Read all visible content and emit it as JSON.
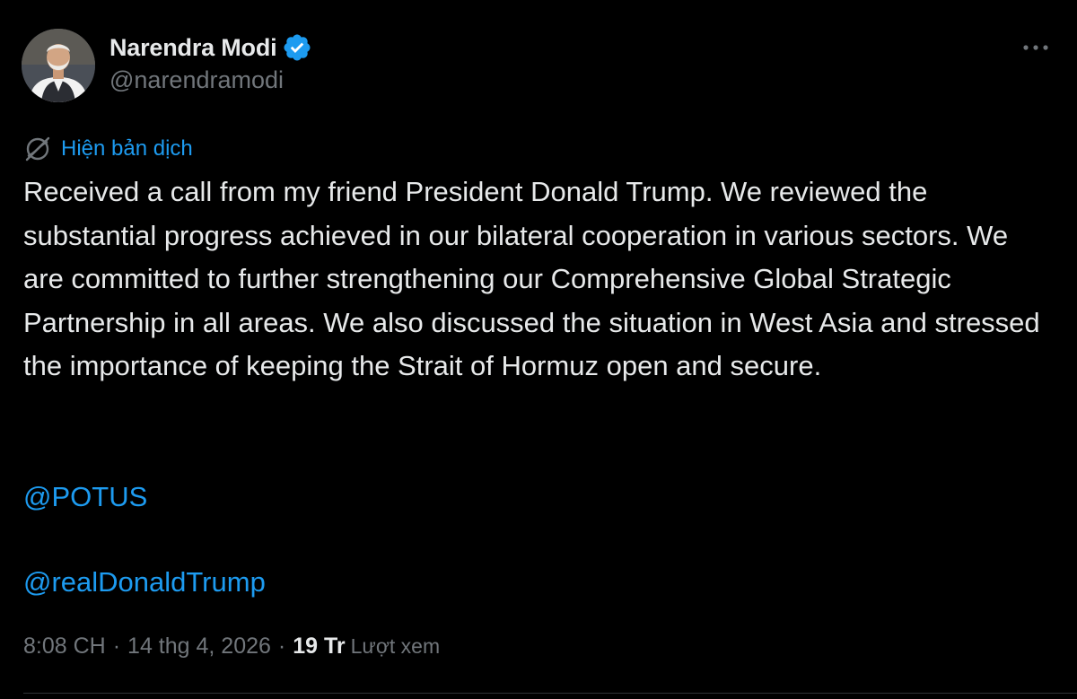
{
  "author": {
    "display_name": "Narendra Modi",
    "handle": "@narendramodi",
    "verified": true
  },
  "translate": {
    "label": "Hiện bản dịch",
    "icon": "translate-icon"
  },
  "tweet": {
    "text": "Received a call from my friend President Donald Trump. We reviewed the substantial progress achieved in our bilateral cooperation in various sectors. We are committed to further strengthening our Comprehensive Global Strategic Partnership in all areas. We also discussed the situation in West Asia and stressed the importance of keeping the Strait of Hormuz open and secure.",
    "mentions": [
      "@POTUS",
      "@realDonaldTrump"
    ]
  },
  "meta": {
    "time": "8:08 CH",
    "separator": "·",
    "date": "14 thg 4, 2026",
    "views_count": "19 Tr",
    "views_label": "Lượt xem"
  },
  "colors": {
    "background": "#000000",
    "text": "#e7e9ea",
    "muted": "#71767b",
    "accent": "#1d9bf0"
  }
}
